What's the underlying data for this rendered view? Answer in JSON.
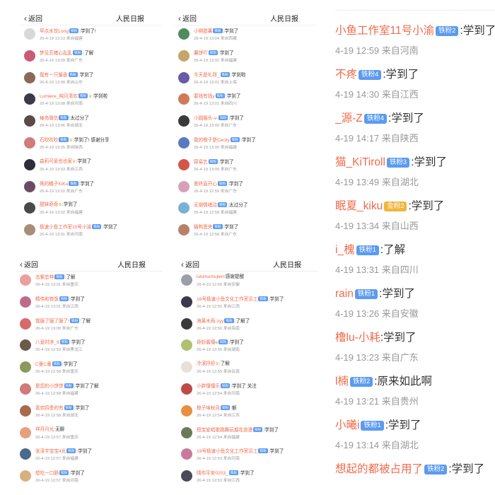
{
  "header": {
    "back_label": "返回",
    "title": "人民日报"
  },
  "colors": {
    "username": "#f06a4a",
    "badge_blue": "#5b9bf0",
    "badge_gold": "#f0b53a",
    "meta_gray": "#999999"
  },
  "panels": [
    {
      "items": [
        {
          "user": "早点水饺Long",
          "badge": "铁粉",
          "crown": false,
          "comment": ":学到了!",
          "meta": "26-4-19 13:13 来自福建",
          "avatar": "#d8d8d8"
        },
        {
          "user": "梦见吾猪心乱乱",
          "badge": "铁粉",
          "crown": false,
          "comment": ":了解",
          "meta": "26-4-19 13:09 来自广东",
          "avatar": "#c95a78"
        },
        {
          "user": "我有一只猫香",
          "badge": "铁粉",
          "crown": false,
          "comment": ":学到了",
          "meta": "26-4-19 13:08 来自山东",
          "avatar": "#8a6a56"
        },
        {
          "user": "Lumiere_纯月清欢",
          "badge": "铁粉",
          "crown": true,
          "comment": ":学到啦",
          "meta": "26-4-19 13:08 来自河南",
          "avatar": "#3a3a48"
        },
        {
          "user": "椿岛微信",
          "badge": "铁粉",
          "crown": false,
          "comment": ":太过分了",
          "meta": "26-4-19 13:06 来自湖北",
          "avatar": "#5b4b46"
        },
        {
          "user": "石吹吹吹",
          "badge": "铁粉",
          "crown": true,
          "comment": ":学到了! 感谢分享",
          "meta": "26-4-19 13:05 来自陕西",
          "avatar": "#d27b7b"
        },
        {
          "user": "森莉可爱也也家",
          "badge": "",
          "crown": true,
          "comment": ":学到了",
          "meta": "26-4-19 13:03 来自江西",
          "avatar": "#2e2e3a"
        },
        {
          "user": "殊的橘子KiKu",
          "badge": "铁粉",
          "crown": false,
          "comment": ":学到了",
          "meta": "26-4-19 13:02 来自广东",
          "avatar": "#6e4a62"
        },
        {
          "user": "甜妹奇奇",
          "badge": "",
          "crown": true,
          "comment": ":学到了",
          "meta": "26-4-19 13:02 来自福建",
          "avatar": "#4a4a4a"
        },
        {
          "user": "极速小鱼工作室10号小渝",
          "badge": "铁粉",
          "crown": false,
          "comment": ":学到了",
          "meta": "26-4-19 13:01 来自河南",
          "avatar": "#a88e76"
        }
      ]
    },
    {
      "items": [
        {
          "user": "小柳甜薯",
          "badge": "铁粉",
          "crown": false,
          "comment": ":学到了",
          "meta": "26-4-19 13:04 来自西藏",
          "avatar": "#4e8c5c"
        },
        {
          "user": "薯饼吖",
          "badge": "铁粉",
          "crown": false,
          "comment": ":学到了",
          "meta": "26-4-19 13:02 来自福建",
          "avatar": "#c8a46a"
        },
        {
          "user": "今天是礼拜_",
          "badge": "铁粉",
          "crown": false,
          "comment": ":学到啦",
          "meta": "26-4-19 13:01 来自上海",
          "avatar": "#6a5aa8"
        },
        {
          "user": "要钱有钱y",
          "badge": "铁粉",
          "crown": false,
          "comment": ":学到了",
          "meta": "26-4-19 13:01 来自四川",
          "avatar": "#d07a5a"
        },
        {
          "user": "小圆猫头-v-",
          "badge": "铁粉",
          "crown": false,
          "comment": ":学到了",
          "meta": "26-4-19 13:00 来自广东",
          "avatar": "#3a3a3a"
        },
        {
          "user": "我的橙子是Cecily",
          "badge": "铁粉",
          "crown": false,
          "comment": ":学到了",
          "meta": "26-4-19 13:00 来自福建",
          "avatar": "#5a7ac0"
        },
        {
          "user": "容易乞",
          "badge": "铁粉",
          "crown": false,
          "comment": ":学到了",
          "meta": "26-4-19 13:00 来自广东",
          "avatar": "#d4564a"
        },
        {
          "user": "意终直开心",
          "badge": "铁粉",
          "crown": false,
          "comment": ":学到了",
          "meta": "26-4-19 12:59 来自广东",
          "avatar": "#d8a0b8"
        },
        {
          "user": "无锡情绪动",
          "badge": "铁粉",
          "crown": false,
          "comment": ":太过分了",
          "meta": "26-4-19 12:58 来自福建",
          "avatar": "#7ab0d8"
        },
        {
          "user": "猫鸭恩夹",
          "badge": "铁粉",
          "crown": false,
          "comment": ":学到了",
          "meta": "26-4-19 12:58 来自广东",
          "avatar": "#b8806a"
        }
      ]
    },
    {
      "items": [
        {
          "user": "击紫恋梓",
          "badge": "铁粉",
          "crown": false,
          "comment": ":了解",
          "meta": "26-4-19 13:01 来自重庆",
          "avatar": "#e8a0a0"
        },
        {
          "user": "精伟和恢饭",
          "badge": "铁粉",
          "crown": false,
          "comment": ":学到了",
          "meta": "26-4-19 13:01 来自江西",
          "avatar": "#c06a8a"
        },
        {
          "user": "我服了服了服了!",
          "badge": "铁粉",
          "crown": false,
          "comment": ":了解",
          "meta": "26-4-19 13:00 来自广东",
          "avatar": "#d86a6a"
        },
        {
          "user": "八爱时序_9",
          "badge": "铁粉",
          "crown": false,
          "comment": ":学到了",
          "meta": "26-4-19 12:59 来自黑龙江",
          "avatar": "#6a5a4a"
        },
        {
          "user": "C童C童",
          "badge": "铁粉",
          "crown": false,
          "comment": ":学到了",
          "meta": "26-4-19 12:58 来自重庆",
          "avatar": "#8a9a5a"
        },
        {
          "user": "是您的小饼饼",
          "badge": "铁粉",
          "crown": false,
          "comment": ":学到了了解",
          "meta": "26-4-19 12:58 来自福建",
          "avatar": "#d07a7a"
        },
        {
          "user": "喜欢四季的有",
          "badge": "铁粉",
          "crown": false,
          "comment": ":学到了",
          "meta": "26-4-19 12:58 来自湖北",
          "avatar": "#a86a4a"
        },
        {
          "user": "祥月月光",
          "badge": "",
          "crown": false,
          "comment": ":无聊",
          "meta": "26-4-19 12:57 来自重庆",
          "avatar": "#e6a080"
        },
        {
          "user": "张泽宇宝宝4光",
          "badge": "铁粉",
          "crown": false,
          "comment": ":学到了",
          "meta": "26-4-19 12:57 来自福建",
          "avatar": "#4a6a8a"
        },
        {
          "user": "想吃一口肠",
          "badge": "铁粉",
          "crown": false,
          "comment": ":学到了",
          "meta": "26-4-19 12:57 来自河南",
          "avatar": "#d8b080"
        }
      ]
    },
    {
      "items": [
        {
          "user": "lulumumujien",
          "badge": "",
          "crown": false,
          "comment": ":感谢提醒",
          "meta": "26-4-19 12:56 来自安徽",
          "avatar": "#9aa0a8"
        },
        {
          "user": "16号极速小鱼文化工作室员工",
          "badge": "铁粉",
          "crown": false,
          "comment": ":学到了",
          "meta": "26-4-19 12:56 来自江西",
          "avatar": "#3a3a4a"
        },
        {
          "user": "海莱木雨-zyy",
          "badge": "铁粉",
          "crown": false,
          "comment": ":了解了",
          "meta": "26-4-19 12:56 来自海南",
          "avatar": "#3a3a3a"
        },
        {
          "user": "奇妙酱懂e",
          "badge": "铁粉",
          "crown": false,
          "comment": ":学到了",
          "meta": "26-4-19 12:56 来自湖南",
          "avatar": "#b0c070"
        },
        {
          "user": "冷漠抒舒",
          "badge": "",
          "crown": true,
          "comment": ":了解",
          "meta": "26-4-19 12:55 来自云南",
          "avatar": "#e8e0d8"
        },
        {
          "user": "小胖懂懂乐",
          "badge": "铁粉",
          "crown": false,
          "comment": ":学到了 关注",
          "meta": "26-4-19 12:54 来自河南",
          "avatar": "#c04a4a"
        },
        {
          "user": "橙子味秋风",
          "badge": "铁粉",
          "crown": false,
          "comment": ":额",
          "meta": "26-4-19 12:54 来自江苏",
          "avatar": "#e89040"
        },
        {
          "user": "短宝爱唱歌跳舞玩烟花浪漫",
          "badge": "铁粉",
          "crown": false,
          "comment": ":学到了",
          "meta": "26-4-19 12:54 来自福建",
          "avatar": "#6a7a5a"
        },
        {
          "user": "19号极速小鱼文化工作室员工",
          "badge": "铁粉",
          "crown": false,
          "comment": ":学到了",
          "meta": "26-4-19 12:53 来自河南",
          "avatar": "#c87a9a"
        },
        {
          "user": "晴你平安0203_",
          "badge": "铁粉",
          "crown": false,
          "comment": ":学到了",
          "meta": "26-4-19 12:53 来自江西",
          "avatar": "#4a4a5a"
        }
      ]
    }
  ],
  "big_panel": {
    "items": [
      {
        "user": "小鱼工作室11号小渝",
        "badge": "铁粉2",
        "gold": false,
        "comment": ":学到了",
        "meta": "4-19 12:59 来自河南"
      },
      {
        "user": "不疼",
        "badge": "铁粉4",
        "gold": false,
        "comment": ":学到了",
        "meta": "4-19 14:30 来自江西"
      },
      {
        "user": "_源-Z",
        "badge": "铁粉4",
        "gold": false,
        "comment": ":学到了",
        "meta": "4-19 14:17 来自陕西"
      },
      {
        "user": "猫_KiTiroll",
        "badge": "铁粉3",
        "gold": false,
        "comment": ":学到了",
        "meta": "4-19 13:49 来自湖北"
      },
      {
        "user": "眠夏_kiku",
        "badge": "金粉2",
        "gold": true,
        "comment": ":学到了",
        "meta": "4-19 13:34 来自山西"
      },
      {
        "user": "i_槐",
        "badge": "铁粉1",
        "gold": false,
        "comment": ":了解",
        "meta": "4-19 13:31 来自四川"
      },
      {
        "user": "rain",
        "badge": "铁粉1",
        "gold": false,
        "comment": ":学到了",
        "meta": "4-19 13:26 来自安徽"
      },
      {
        "user": "橹lu-小耗",
        "badge": "",
        "gold": false,
        "comment": ":学到了",
        "meta": "4-19 13:23 来自广东"
      },
      {
        "user": "l楠",
        "badge": "铁粉2",
        "gold": false,
        "comment": ":原来如此啊",
        "meta": "4-19 13:21 来自贵州"
      },
      {
        "user": "小曦i",
        "badge": "铁粉1",
        "gold": false,
        "comment": ":学到了",
        "meta": "4-19 13:14 来自湖北"
      },
      {
        "user": "想起的都被占用了",
        "badge": "铁粉2",
        "gold": false,
        "comment": ":学到了",
        "meta": ""
      }
    ]
  }
}
